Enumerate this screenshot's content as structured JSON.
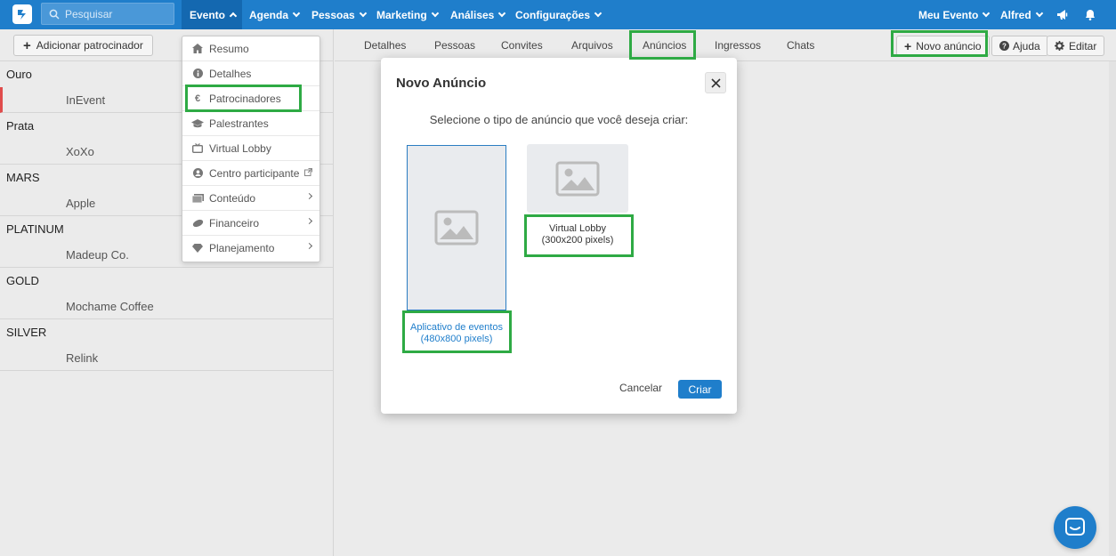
{
  "nav": {
    "search_placeholder": "Pesquisar",
    "items": [
      {
        "label": "Evento"
      },
      {
        "label": "Agenda"
      },
      {
        "label": "Pessoas"
      },
      {
        "label": "Marketing"
      },
      {
        "label": "Análises"
      },
      {
        "label": "Configurações"
      }
    ],
    "event_label": "Meu Evento",
    "user_label": "Alfred"
  },
  "left": {
    "add_button": "Adicionar patrocinador",
    "groups": [
      {
        "name": "Ouro",
        "item": "InEvent"
      },
      {
        "name": "Prata",
        "item": "XoXo"
      },
      {
        "name": "MARS",
        "item": "Apple"
      },
      {
        "name": "PLATINUM",
        "item": "Madeup Co."
      },
      {
        "name": "GOLD",
        "item": "Mochame Coffee"
      },
      {
        "name": "SILVER",
        "item": "Relink"
      }
    ]
  },
  "tabs": [
    "Detalhes",
    "Pessoas",
    "Convites",
    "Arquivos",
    "Anúncios",
    "Ingressos",
    "Chats"
  ],
  "toolbar": {
    "new_ad": "Novo anúncio",
    "help": "Ajuda",
    "edit": "Editar"
  },
  "dropdown": {
    "items": [
      {
        "label": "Resumo",
        "icon": "home-icon"
      },
      {
        "label": "Detalhes",
        "icon": "info-icon"
      },
      {
        "label": "Patrocinadores",
        "icon": "euro-icon"
      },
      {
        "label": "Palestrantes",
        "icon": "graduation-cap-icon"
      },
      {
        "label": "Virtual Lobby",
        "icon": "tv-icon"
      },
      {
        "label": "Centro participante",
        "icon": "user-circle-icon"
      },
      {
        "label": "Conteúdo",
        "icon": "images-icon"
      },
      {
        "label": "Financeiro",
        "icon": "money-icon"
      },
      {
        "label": "Planejamento",
        "icon": "diamond-icon"
      }
    ]
  },
  "modal": {
    "title": "Novo Anúncio",
    "subtitle": "Selecione o tipo de anúncio que você deseja criar:",
    "option_app_line1": "Aplicativo de eventos",
    "option_app_line2": "(480x800 pixels)",
    "option_lobby_line1": "Virtual Lobby",
    "option_lobby_line2": "(300x200 pixels)",
    "cancel": "Cancelar",
    "create": "Criar"
  },
  "colors": {
    "brand": "#1f7ecb",
    "highlight": "#2eaa44",
    "selection": "#e04c4c"
  }
}
